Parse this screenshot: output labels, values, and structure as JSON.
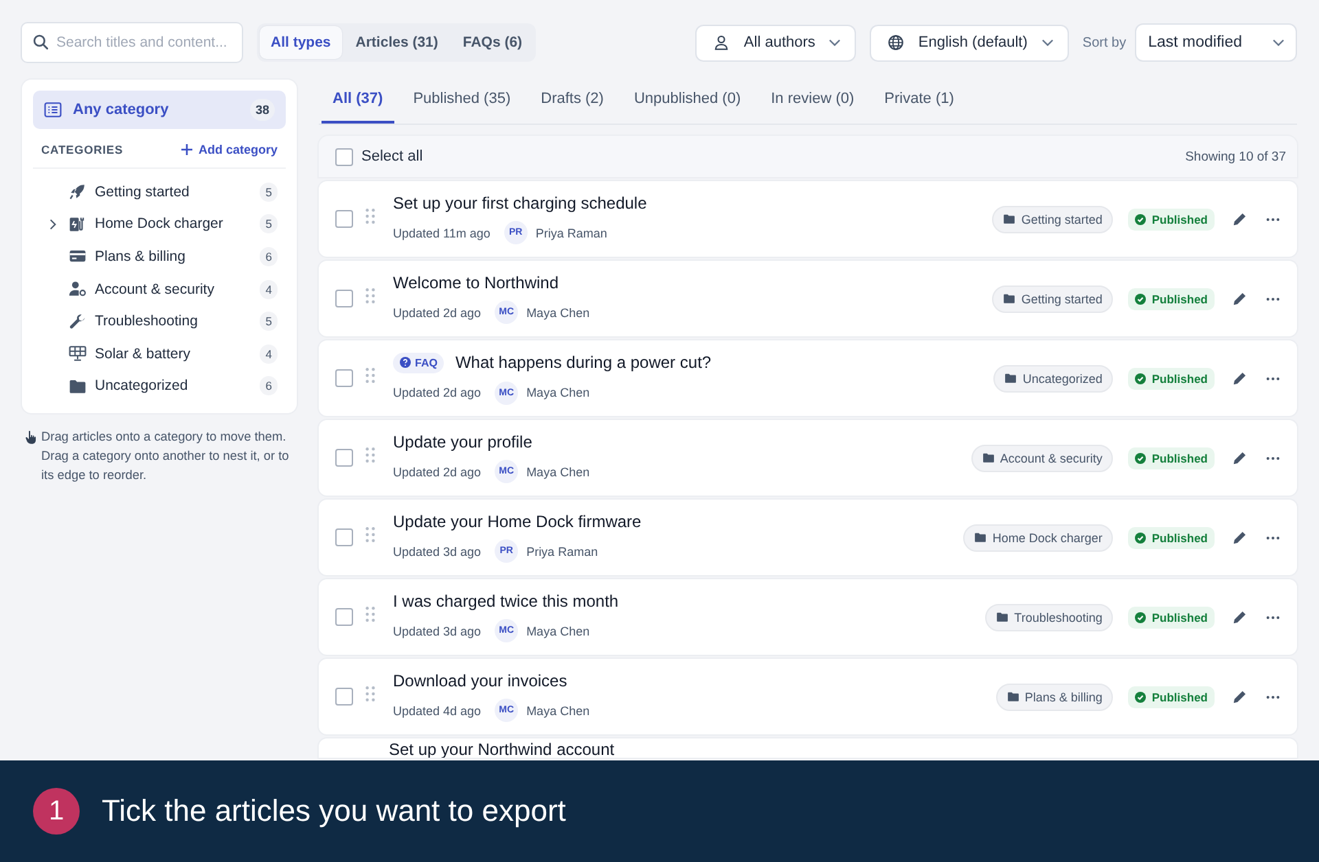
{
  "search": {
    "placeholder": "Search titles and content..."
  },
  "type_filters": [
    {
      "label": "All types",
      "selected": true
    },
    {
      "label": "Articles (31)",
      "selected": false
    },
    {
      "label": "FAQs (6)",
      "selected": false
    }
  ],
  "author_filter": {
    "value": "All authors"
  },
  "language_filter": {
    "value": "English (default)"
  },
  "sort": {
    "label": "Sort by",
    "value": "Last modified"
  },
  "sidebar": {
    "any_category": {
      "label": "Any category",
      "count": "38",
      "selected": true
    },
    "heading": "CATEGORIES",
    "add_label": "Add category",
    "items": [
      {
        "label": "Getting started",
        "count": "5",
        "collapsible": false
      },
      {
        "label": "Home Dock charger",
        "count": "5",
        "collapsible": true
      },
      {
        "label": "Plans & billing",
        "count": "6",
        "collapsible": false
      },
      {
        "label": "Account & security",
        "count": "4",
        "collapsible": false
      },
      {
        "label": "Troubleshooting",
        "count": "5",
        "collapsible": false
      },
      {
        "label": "Solar & battery",
        "count": "4",
        "collapsible": false
      },
      {
        "label": "Uncategorized",
        "count": "6",
        "collapsible": false
      }
    ],
    "hint": "Drag articles onto a category to move them. Drag a category onto another to nest it, or to its edge to reorder."
  },
  "status_tabs": [
    {
      "label": "All (37)",
      "selected": true
    },
    {
      "label": "Published (35)",
      "selected": false
    },
    {
      "label": "Drafts (2)",
      "selected": false
    },
    {
      "label": "Unpublished (0)",
      "selected": false
    },
    {
      "label": "In review (0)",
      "selected": false
    },
    {
      "label": "Private (1)",
      "selected": false
    }
  ],
  "list": {
    "select_all": {
      "label": "Select all",
      "checked": false
    },
    "showing": "Showing 10 of 37",
    "rows": [
      {
        "kind": "article",
        "title": "Set up your first charging schedule",
        "updated": "Updated 11m ago",
        "initials": "PR",
        "author": "Priya Raman",
        "category": "Getting started",
        "status": "Published",
        "checked": false
      },
      {
        "kind": "article",
        "title": "Welcome to Northwind",
        "updated": "Updated 2d ago",
        "initials": "MC",
        "author": "Maya Chen",
        "category": "Getting started",
        "status": "Published",
        "checked": false
      },
      {
        "kind": "faq",
        "badge": "FAQ",
        "title": "What happens during a power cut?",
        "updated": "Updated 2d ago",
        "initials": "MC",
        "author": "Maya Chen",
        "category": "Uncategorized",
        "status": "Published",
        "checked": false
      },
      {
        "kind": "article",
        "title": "Update your profile",
        "updated": "Updated 2d ago",
        "initials": "MC",
        "author": "Maya Chen",
        "category": "Account & security",
        "status": "Published",
        "checked": false
      },
      {
        "kind": "article",
        "title": "Update your Home Dock firmware",
        "updated": "Updated 3d ago",
        "initials": "PR",
        "author": "Priya Raman",
        "category": "Home Dock charger",
        "status": "Published",
        "checked": false
      },
      {
        "kind": "article",
        "title": "I was charged twice this month",
        "updated": "Updated 3d ago",
        "initials": "MC",
        "author": "Maya Chen",
        "category": "Troubleshooting",
        "status": "Published",
        "checked": false
      },
      {
        "kind": "article",
        "title": "Download your invoices",
        "updated": "Updated 4d ago",
        "initials": "MC",
        "author": "Maya Chen",
        "category": "Plans & billing",
        "status": "Published",
        "checked": false
      },
      {
        "kind": "partial",
        "title": "Set up your Northwind account"
      }
    ]
  },
  "caption": {
    "step": "1",
    "text": "Tick the articles you want to export"
  }
}
